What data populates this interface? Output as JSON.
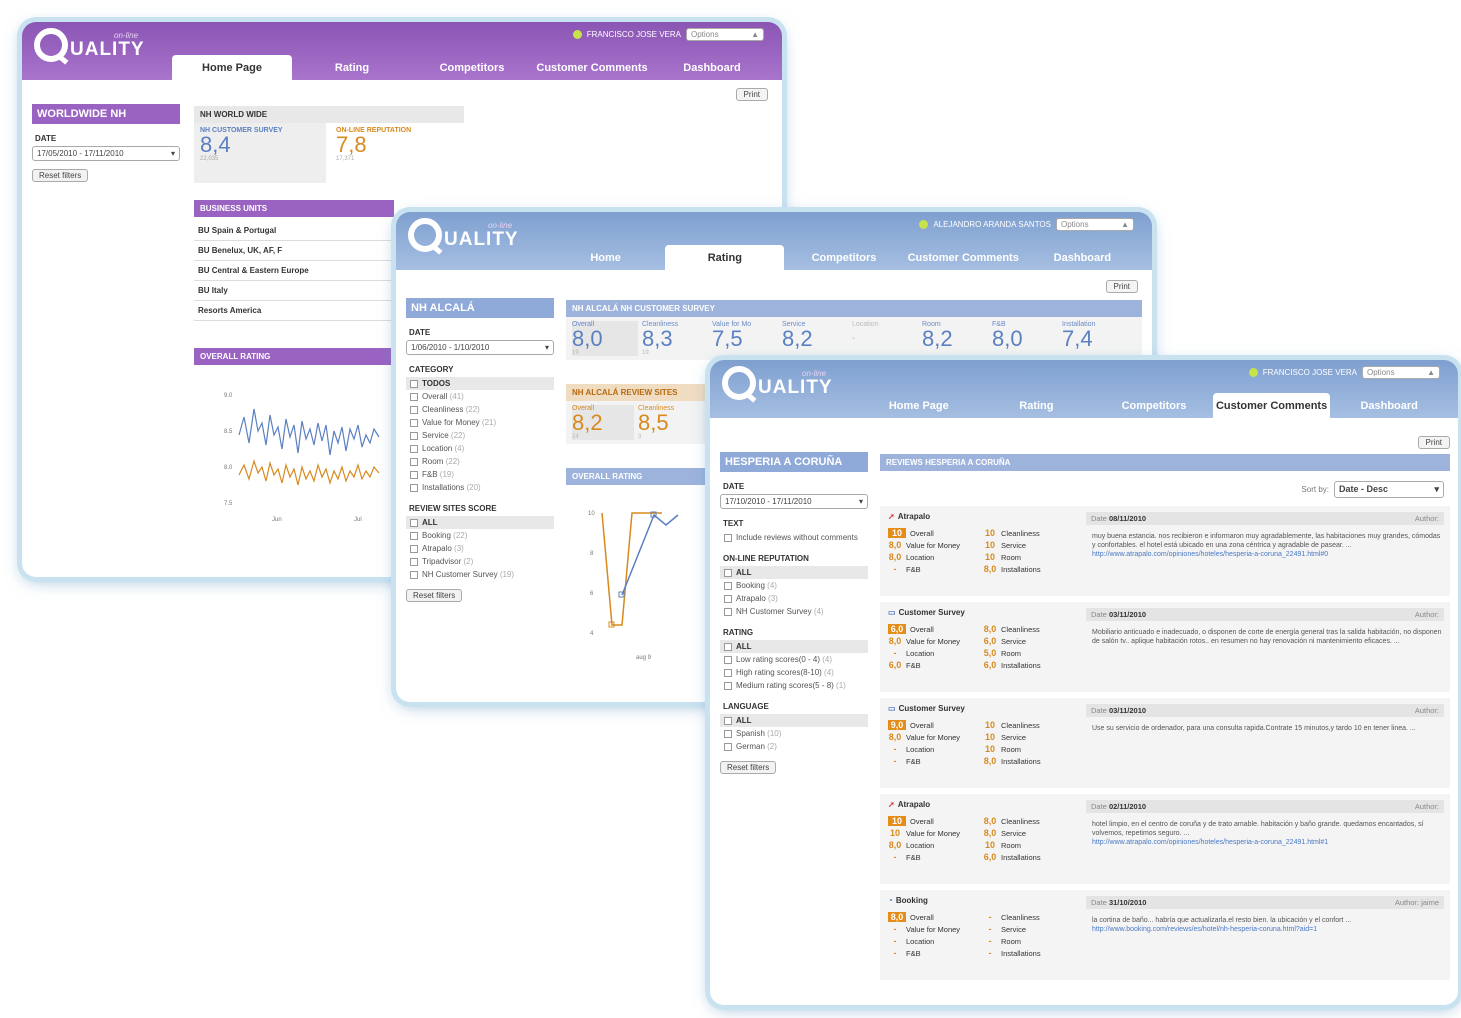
{
  "logo": {
    "text": "UALITY",
    "sub": "on-line"
  },
  "win1": {
    "user": "FRANCISCO JOSE VERA",
    "options": "Options",
    "tabs": [
      "Home Page",
      "Rating",
      "Competitors",
      "Customer Comments",
      "Dashboard"
    ],
    "print": "Print",
    "sidebar": {
      "title": "WORLDWIDE NH",
      "date_label": "DATE",
      "date_value": "17/05/2010 - 17/11/2010",
      "reset": "Reset filters"
    },
    "world": {
      "title": "NH WORLD WIDE",
      "survey_label": "NH CUSTOMER SURVEY",
      "survey_value": "8,4",
      "survey_sub": "22,035",
      "rep_label": "ON-LINE REPUTATION",
      "rep_value": "7,8",
      "rep_sub": "17,371"
    },
    "bu": {
      "title": "BUSINESS UNITS",
      "rows": [
        "BU Spain & Portugal",
        "BU Benelux, UK, AF, F",
        "BU Central & Eastern Europe",
        "BU Italy",
        "Resorts America"
      ]
    },
    "overall": {
      "title": "OVERALL RATING",
      "yticks": [
        "9.0",
        "8.5",
        "8.0",
        "7.5"
      ],
      "xticks": [
        "Jun",
        "Jul"
      ]
    }
  },
  "win2": {
    "user": "ALEJANDRO ARANDA SANTOS",
    "options": "Options",
    "tabs": [
      "Home",
      "Rating",
      "Competitors",
      "Customer Comments",
      "Dashboard"
    ],
    "print": "Print",
    "sidebar": {
      "title": "NH ALCALÁ",
      "date_label": "DATE",
      "date_value": "1/06/2010 - 1/10/2010",
      "category_label": "CATEGORY",
      "categories": [
        {
          "label": "TODOS",
          "count": ""
        },
        {
          "label": "Overall",
          "count": "(41)"
        },
        {
          "label": "Cleanliness",
          "count": "(22)"
        },
        {
          "label": "Value for Money",
          "count": "(21)"
        },
        {
          "label": "Service",
          "count": "(22)"
        },
        {
          "label": "Location",
          "count": "(4)"
        },
        {
          "label": "Room",
          "count": "(22)"
        },
        {
          "label": "F&B",
          "count": "(19)"
        },
        {
          "label": "Installations",
          "count": "(20)"
        }
      ],
      "sites_label": "REVIEW SITES SCORE",
      "sites": [
        {
          "label": "ALL",
          "count": ""
        },
        {
          "label": "Booking",
          "count": "(22)"
        },
        {
          "label": "Atrapalo",
          "count": "(3)"
        },
        {
          "label": "Tripadvisor",
          "count": "(2)"
        },
        {
          "label": "NH Customer Survey",
          "count": "(19)"
        }
      ],
      "reset": "Reset filters"
    },
    "survey": {
      "title": "NH ALCALÁ NH CUSTOMER SURVEY",
      "metrics": [
        {
          "label": "Overall",
          "value": "8,0",
          "sub": "19"
        },
        {
          "label": "Cleanliness",
          "value": "8,3",
          "sub": "19"
        },
        {
          "label": "Value for Mo",
          "value": "7,5",
          "sub": ""
        },
        {
          "label": "Service",
          "value": "8,2",
          "sub": ""
        },
        {
          "label": "Location",
          "value": "-",
          "sub": ""
        },
        {
          "label": "Room",
          "value": "8,2",
          "sub": ""
        },
        {
          "label": "F&B",
          "value": "8,0",
          "sub": ""
        },
        {
          "label": "Installation",
          "value": "7,4",
          "sub": ""
        }
      ]
    },
    "sites_score": {
      "title": "NH ALCALÁ REVIEW SITES",
      "metrics": [
        {
          "label": "Overall",
          "value": "8,2",
          "sub": "24"
        },
        {
          "label": "Cleanliness",
          "value": "8,5",
          "sub": "3"
        }
      ]
    },
    "overall": {
      "title": "OVERALL RATING",
      "yticks": [
        "10",
        "8",
        "6",
        "4"
      ],
      "xtick": "aug 9"
    }
  },
  "win3": {
    "user": "FRANCISCO JOSE VERA",
    "options": "Options",
    "tabs": [
      "Home Page",
      "Rating",
      "Competitors",
      "Customer Comments",
      "Dashboard"
    ],
    "print": "Print",
    "sidebar": {
      "title": "HESPERIA A CORUÑA",
      "date_label": "DATE",
      "date_value": "17/10/2010 - 17/11/2010",
      "text_label": "TEXT",
      "text_option": "Include reviews without comments",
      "rep_label": "ON-LINE REPUTATION",
      "rep": [
        {
          "label": "ALL",
          "count": ""
        },
        {
          "label": "Booking",
          "count": "(4)"
        },
        {
          "label": "Atrapalo",
          "count": "(3)"
        },
        {
          "label": "NH Customer Survey",
          "count": "(4)"
        }
      ],
      "rating_label": "RATING",
      "rating": [
        {
          "label": "ALL",
          "count": ""
        },
        {
          "label": "Low rating scores(0 - 4)",
          "count": "(4)"
        },
        {
          "label": "High rating scores(8-10)",
          "count": "(4)"
        },
        {
          "label": "Medium rating scores(5 - 8)",
          "count": "(1)"
        }
      ],
      "lang_label": "LANGUAGE",
      "lang": [
        {
          "label": "ALL",
          "count": ""
        },
        {
          "label": "Spanish",
          "count": "(10)"
        },
        {
          "label": "German",
          "count": "(2)"
        }
      ],
      "reset": "Reset filters"
    },
    "reviews_title": "REVIEWS HESPERIA A CORUÑA",
    "sort_label": "Sort by:",
    "sort_value": "Date - Desc",
    "reviews": [
      {
        "source": "Atrapalo",
        "kind": "atr",
        "date_label": "Date",
        "date": "08/11/2010",
        "author": "Author:",
        "scores": [
          [
            "10",
            "Overall"
          ],
          [
            "10",
            "Cleanliness"
          ],
          [
            "8,0",
            "Value for Money"
          ],
          [
            "10",
            "Service"
          ],
          [
            "8,0",
            "Location"
          ],
          [
            "10",
            "Room"
          ],
          [
            "-",
            "F&B"
          ],
          [
            "8,0",
            "Installations"
          ]
        ],
        "text": "muy buena estancia. nos recibieron e informaron muy agradablemente, las habitaciones muy grandes, cómodas y confortables. el hotel está ubicado en una zona céntrica y agradable de pasear. ...",
        "link": "http://www.atrapalo.com/opiniones/hoteles/hesperia-a-coruna_22491.html#0"
      },
      {
        "source": "Customer Survey",
        "kind": "cs",
        "date_label": "Date",
        "date": "03/11/2010",
        "author": "Author:",
        "scores": [
          [
            "6,0",
            "Overall"
          ],
          [
            "8,0",
            "Cleanliness"
          ],
          [
            "8,0",
            "Value for Money"
          ],
          [
            "6,0",
            "Service"
          ],
          [
            "-",
            "Location"
          ],
          [
            "5,0",
            "Room"
          ],
          [
            "6,0",
            "F&B"
          ],
          [
            "6,0",
            "Installations"
          ]
        ],
        "text": "Mobiliario anticuado e inadecuado, o disponen de corte de energía general tras la salida habitación, no disponen de salón tv.. aplique habitación rotos.. en resumen no hay renovación ni mantenimiento eficaces. ...",
        "link": ""
      },
      {
        "source": "Customer Survey",
        "kind": "cs",
        "date_label": "Date",
        "date": "03/11/2010",
        "author": "Author:",
        "scores": [
          [
            "9,0",
            "Overall"
          ],
          [
            "10",
            "Cleanliness"
          ],
          [
            "8,0",
            "Value for Money"
          ],
          [
            "10",
            "Service"
          ],
          [
            "-",
            "Location"
          ],
          [
            "10",
            "Room"
          ],
          [
            "-",
            "F&B"
          ],
          [
            "8,0",
            "Installations"
          ]
        ],
        "text": "Use su servicio de ordenador, para una consulta rapida.Contrate 15 minutos,y tardo 10 en tener linea. ...",
        "link": ""
      },
      {
        "source": "Atrapalo",
        "kind": "atr",
        "date_label": "Date",
        "date": "02/11/2010",
        "author": "Author:",
        "scores": [
          [
            "10",
            "Overall"
          ],
          [
            "8,0",
            "Cleanliness"
          ],
          [
            "10",
            "Value for Money"
          ],
          [
            "8,0",
            "Service"
          ],
          [
            "8,0",
            "Location"
          ],
          [
            "10",
            "Room"
          ],
          [
            "-",
            "F&B"
          ],
          [
            "6,0",
            "Installations"
          ]
        ],
        "text": "hotel limpio, en el centro de coruña y de trato amable. habitación y baño grande. quedamos encantados, sí volvemos, repetimos seguro. ...",
        "link": "http://www.atrapalo.com/opiniones/hoteles/hesperia-a-coruna_22491.html#1"
      },
      {
        "source": "Booking",
        "kind": "bk",
        "date_label": "Date",
        "date": "31/10/2010",
        "author": "Author: jaime",
        "scores": [
          [
            "8,0",
            "Overall"
          ],
          [
            "-",
            "Cleanliness"
          ],
          [
            "-",
            "Value for Money"
          ],
          [
            "-",
            "Service"
          ],
          [
            "-",
            "Location"
          ],
          [
            "-",
            "Room"
          ],
          [
            "-",
            "F&B"
          ],
          [
            "-",
            "Installations"
          ]
        ],
        "text": "la cortina de baño... habría que actualizarla.el resto bien. la ubicación y el confort ...",
        "link": "http://www.booking.com/reviews/es/hotel/nh-hesperia-coruna.html?aid=1"
      }
    ]
  },
  "colors": {
    "purple": "#9a63c2",
    "blue": "#8fa9d8",
    "orange": "#e58d1a",
    "chart_blue": "#5b80c2"
  }
}
